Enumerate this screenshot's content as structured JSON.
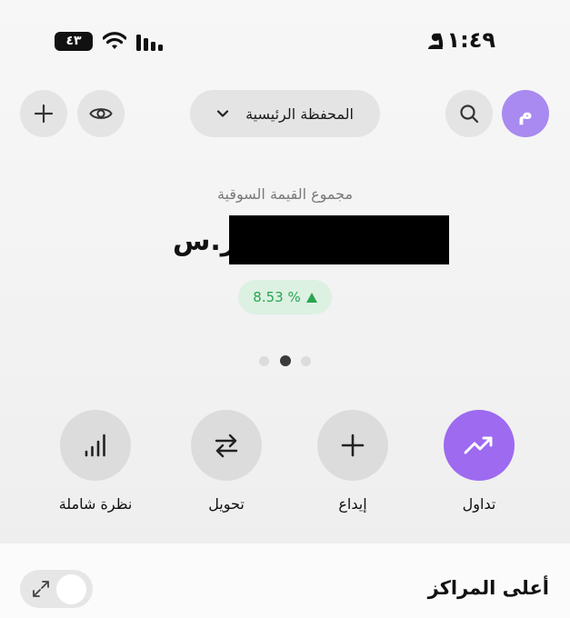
{
  "status_bar": {
    "time": "١١:٤٩",
    "battery": "٤٣"
  },
  "header": {
    "avatar_letter": "م",
    "portfolio_selector": "المحفظة الرئيسية"
  },
  "balance": {
    "label": "مجموع القيمة السوقية",
    "currency": "ر.س",
    "change": "8.53 %",
    "change_direction": "up",
    "colors": {
      "positive": "#2aa552",
      "accent": "#9d6af0"
    }
  },
  "pager": {
    "pages": 3,
    "active_index": 1
  },
  "actions": [
    {
      "label": "تداول",
      "icon": "trending-up-icon"
    },
    {
      "label": "إيداع",
      "icon": "plus-icon"
    },
    {
      "label": "تحويل",
      "icon": "transfer-icon"
    },
    {
      "label": "نظرة شاملة",
      "icon": "bar-chart-icon"
    }
  ],
  "section": {
    "title": "أعلى المراكز"
  }
}
